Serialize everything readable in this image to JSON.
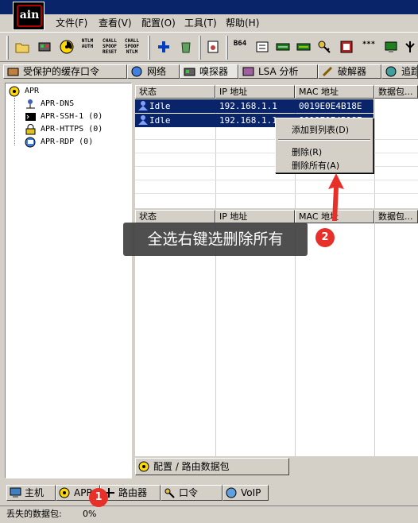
{
  "menu": {
    "file": "文件(F)",
    "view": "查看(V)",
    "config": "配置(O)",
    "tools": "工具(T)",
    "help": "帮助(H)"
  },
  "logo_text": "ain",
  "toolbar": {
    "ntlm_auth": "NTLM\nAUTH",
    "chall_reset": "CHALL\nSPOOF\nRESET",
    "chall_ntlm": "CHALL\nSPOOF\nNTLM",
    "b64": "B64",
    "stars": "***"
  },
  "tabs": [
    {
      "label": "受保护的缓存口令"
    },
    {
      "label": "网络"
    },
    {
      "label": "嗅探器"
    },
    {
      "label": "LSA 分析"
    },
    {
      "label": "破解器"
    },
    {
      "label": "追踪"
    }
  ],
  "tree": {
    "root": "APR",
    "children": [
      "APR-DNS",
      "APR-SSH-1 (0)",
      "APR-HTTPS (0)",
      "APR-RDP (0)"
    ]
  },
  "grid_top": {
    "headers": [
      "状态",
      "IP 地址",
      "MAC 地址",
      "数据包..."
    ],
    "rows": [
      {
        "status": "Idle",
        "ip": "192.168.1.1",
        "mac": "0019E0E4B18E"
      },
      {
        "status": "Idle",
        "ip": "192.168.1.1",
        "mac": "0019E0E4B18E"
      }
    ]
  },
  "grid_bottom": {
    "headers": [
      "状态",
      "IP 地址",
      "MAC 地址",
      "数据包..."
    ]
  },
  "context_menu": {
    "add_to_list": "添加到列表(D)",
    "delete": "删除(R)",
    "delete_all": "删除所有(A)"
  },
  "annotation": {
    "callout": "全选右键选删除所有",
    "badge1": "1",
    "badge2": "2"
  },
  "config_tab": "配置 / 路由数据包",
  "bottom_tabs": [
    {
      "label": "主机"
    },
    {
      "label": "APR"
    },
    {
      "label": "路由器"
    },
    {
      "label": "口令"
    },
    {
      "label": "VoIP"
    }
  ],
  "status": {
    "label": "丢失的数据包:",
    "value": "0%"
  },
  "colors": {
    "selection": "#0a246a",
    "annotation_red": "#e8302a",
    "window_face": "#d4d0c8"
  }
}
